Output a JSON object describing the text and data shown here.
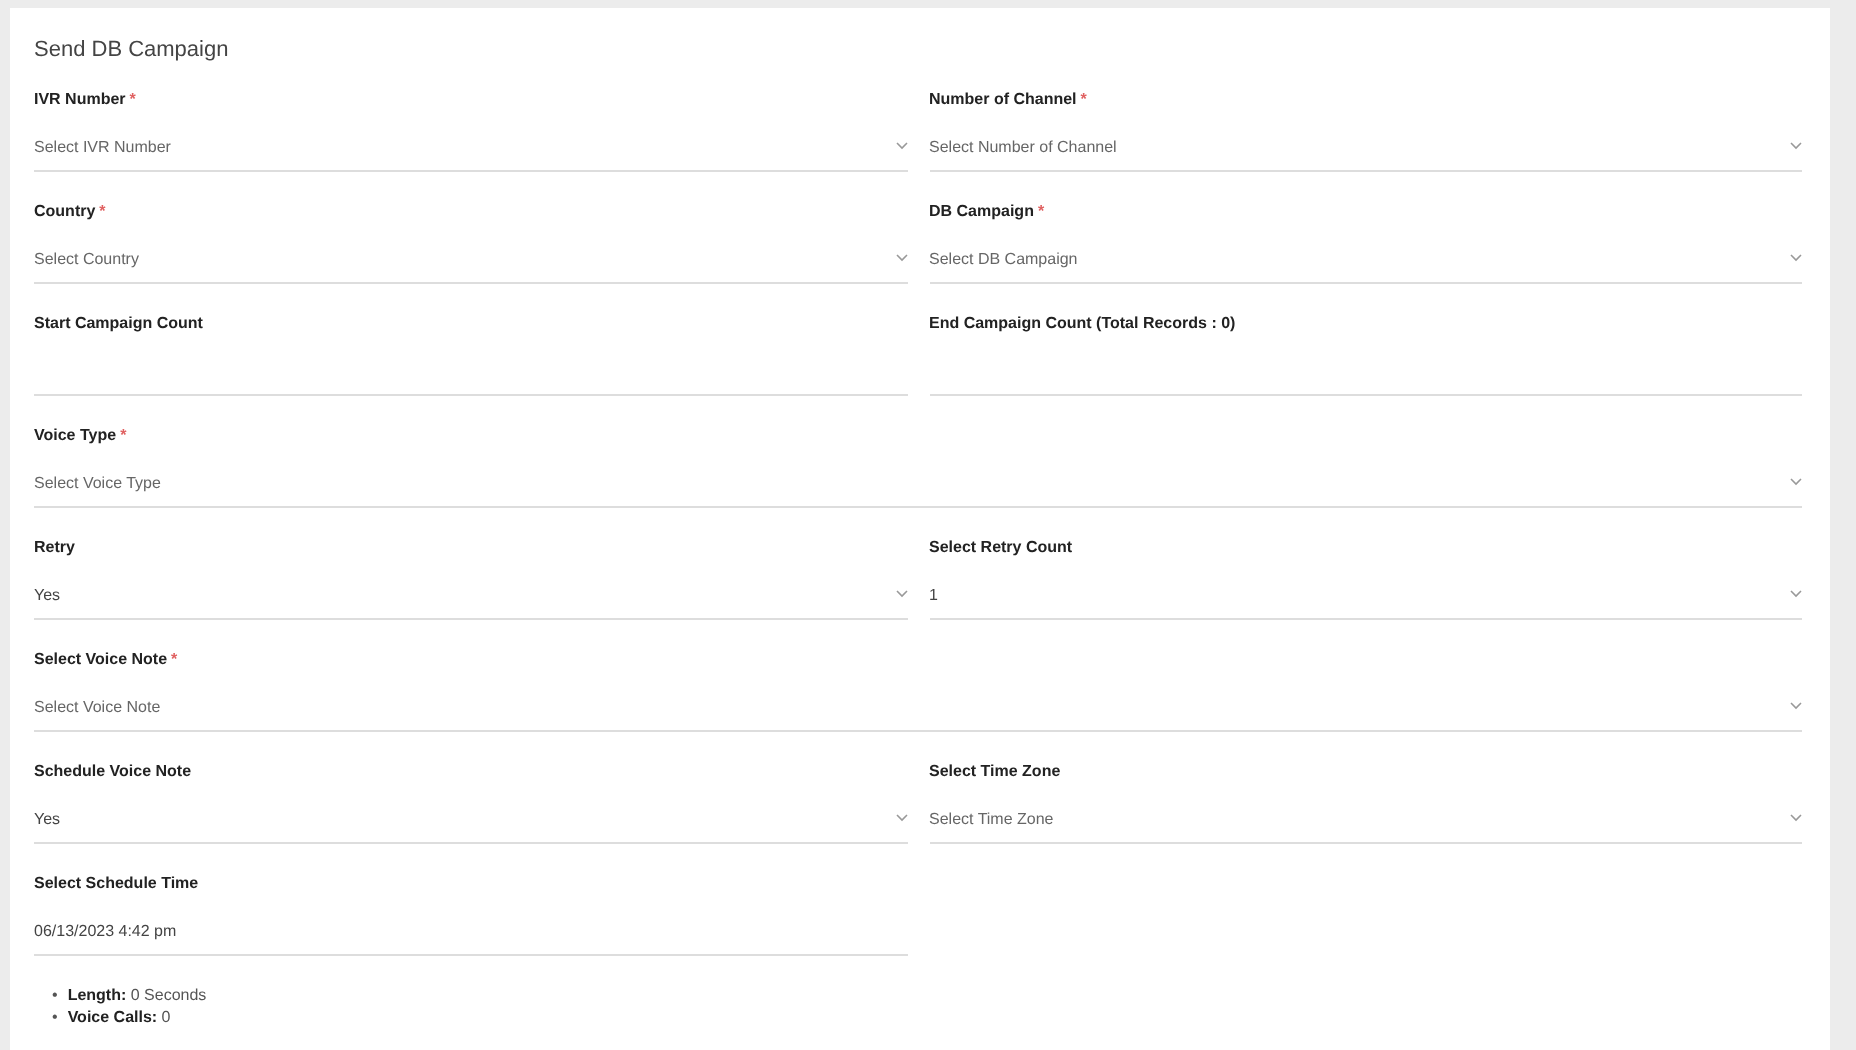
{
  "card": {
    "title": "Send DB Campaign"
  },
  "rows": [
    {
      "kind": "split",
      "fields": [
        {
          "label": "IVR Number",
          "required_mark": "*",
          "kind": "select",
          "placeholder": "Select IVR Number"
        },
        {
          "label": "Number of Channel",
          "required_mark": "*",
          "kind": "select",
          "placeholder": "Select Number of Channel"
        }
      ]
    },
    {
      "kind": "split",
      "fields": [
        {
          "label": "Country",
          "required_mark": "*",
          "kind": "select",
          "placeholder": "Select Country"
        },
        {
          "label": "DB Campaign",
          "required_mark": "*",
          "kind": "select",
          "placeholder": "Select DB Campaign"
        }
      ]
    },
    {
      "kind": "split",
      "fields": [
        {
          "label": "Start Campaign Count",
          "kind": "text"
        },
        {
          "label": "End Campaign Count (Total Records : 0)",
          "kind": "text"
        }
      ]
    },
    {
      "kind": "full",
      "fields": [
        {
          "label": "Voice Type",
          "required_mark": "*",
          "kind": "select",
          "placeholder": "Select Voice Type"
        }
      ]
    },
    {
      "kind": "split",
      "fields": [
        {
          "label": "Retry",
          "kind": "select",
          "value": "Yes"
        },
        {
          "label": "Select Retry Count",
          "kind": "select",
          "value": "1"
        }
      ]
    },
    {
      "kind": "full",
      "fields": [
        {
          "label": "Select Voice Note",
          "required_mark": "*",
          "kind": "select",
          "placeholder": "Select Voice Note"
        }
      ]
    },
    {
      "kind": "split",
      "fields": [
        {
          "label": "Schedule Voice Note",
          "kind": "select",
          "value": "Yes"
        },
        {
          "label": "Select Time Zone",
          "kind": "select",
          "placeholder": "Select Time Zone"
        }
      ]
    },
    {
      "kind": "half",
      "fields": [
        {
          "label": "Select Schedule Time",
          "kind": "text",
          "value": "06/13/2023 4:42 pm"
        }
      ]
    }
  ],
  "info": [
    {
      "bullet": "•",
      "text": "**Length:** 0 Seconds"
    },
    {
      "bullet": "•",
      "text": "**Voice Calls:** 0"
    }
  ]
}
